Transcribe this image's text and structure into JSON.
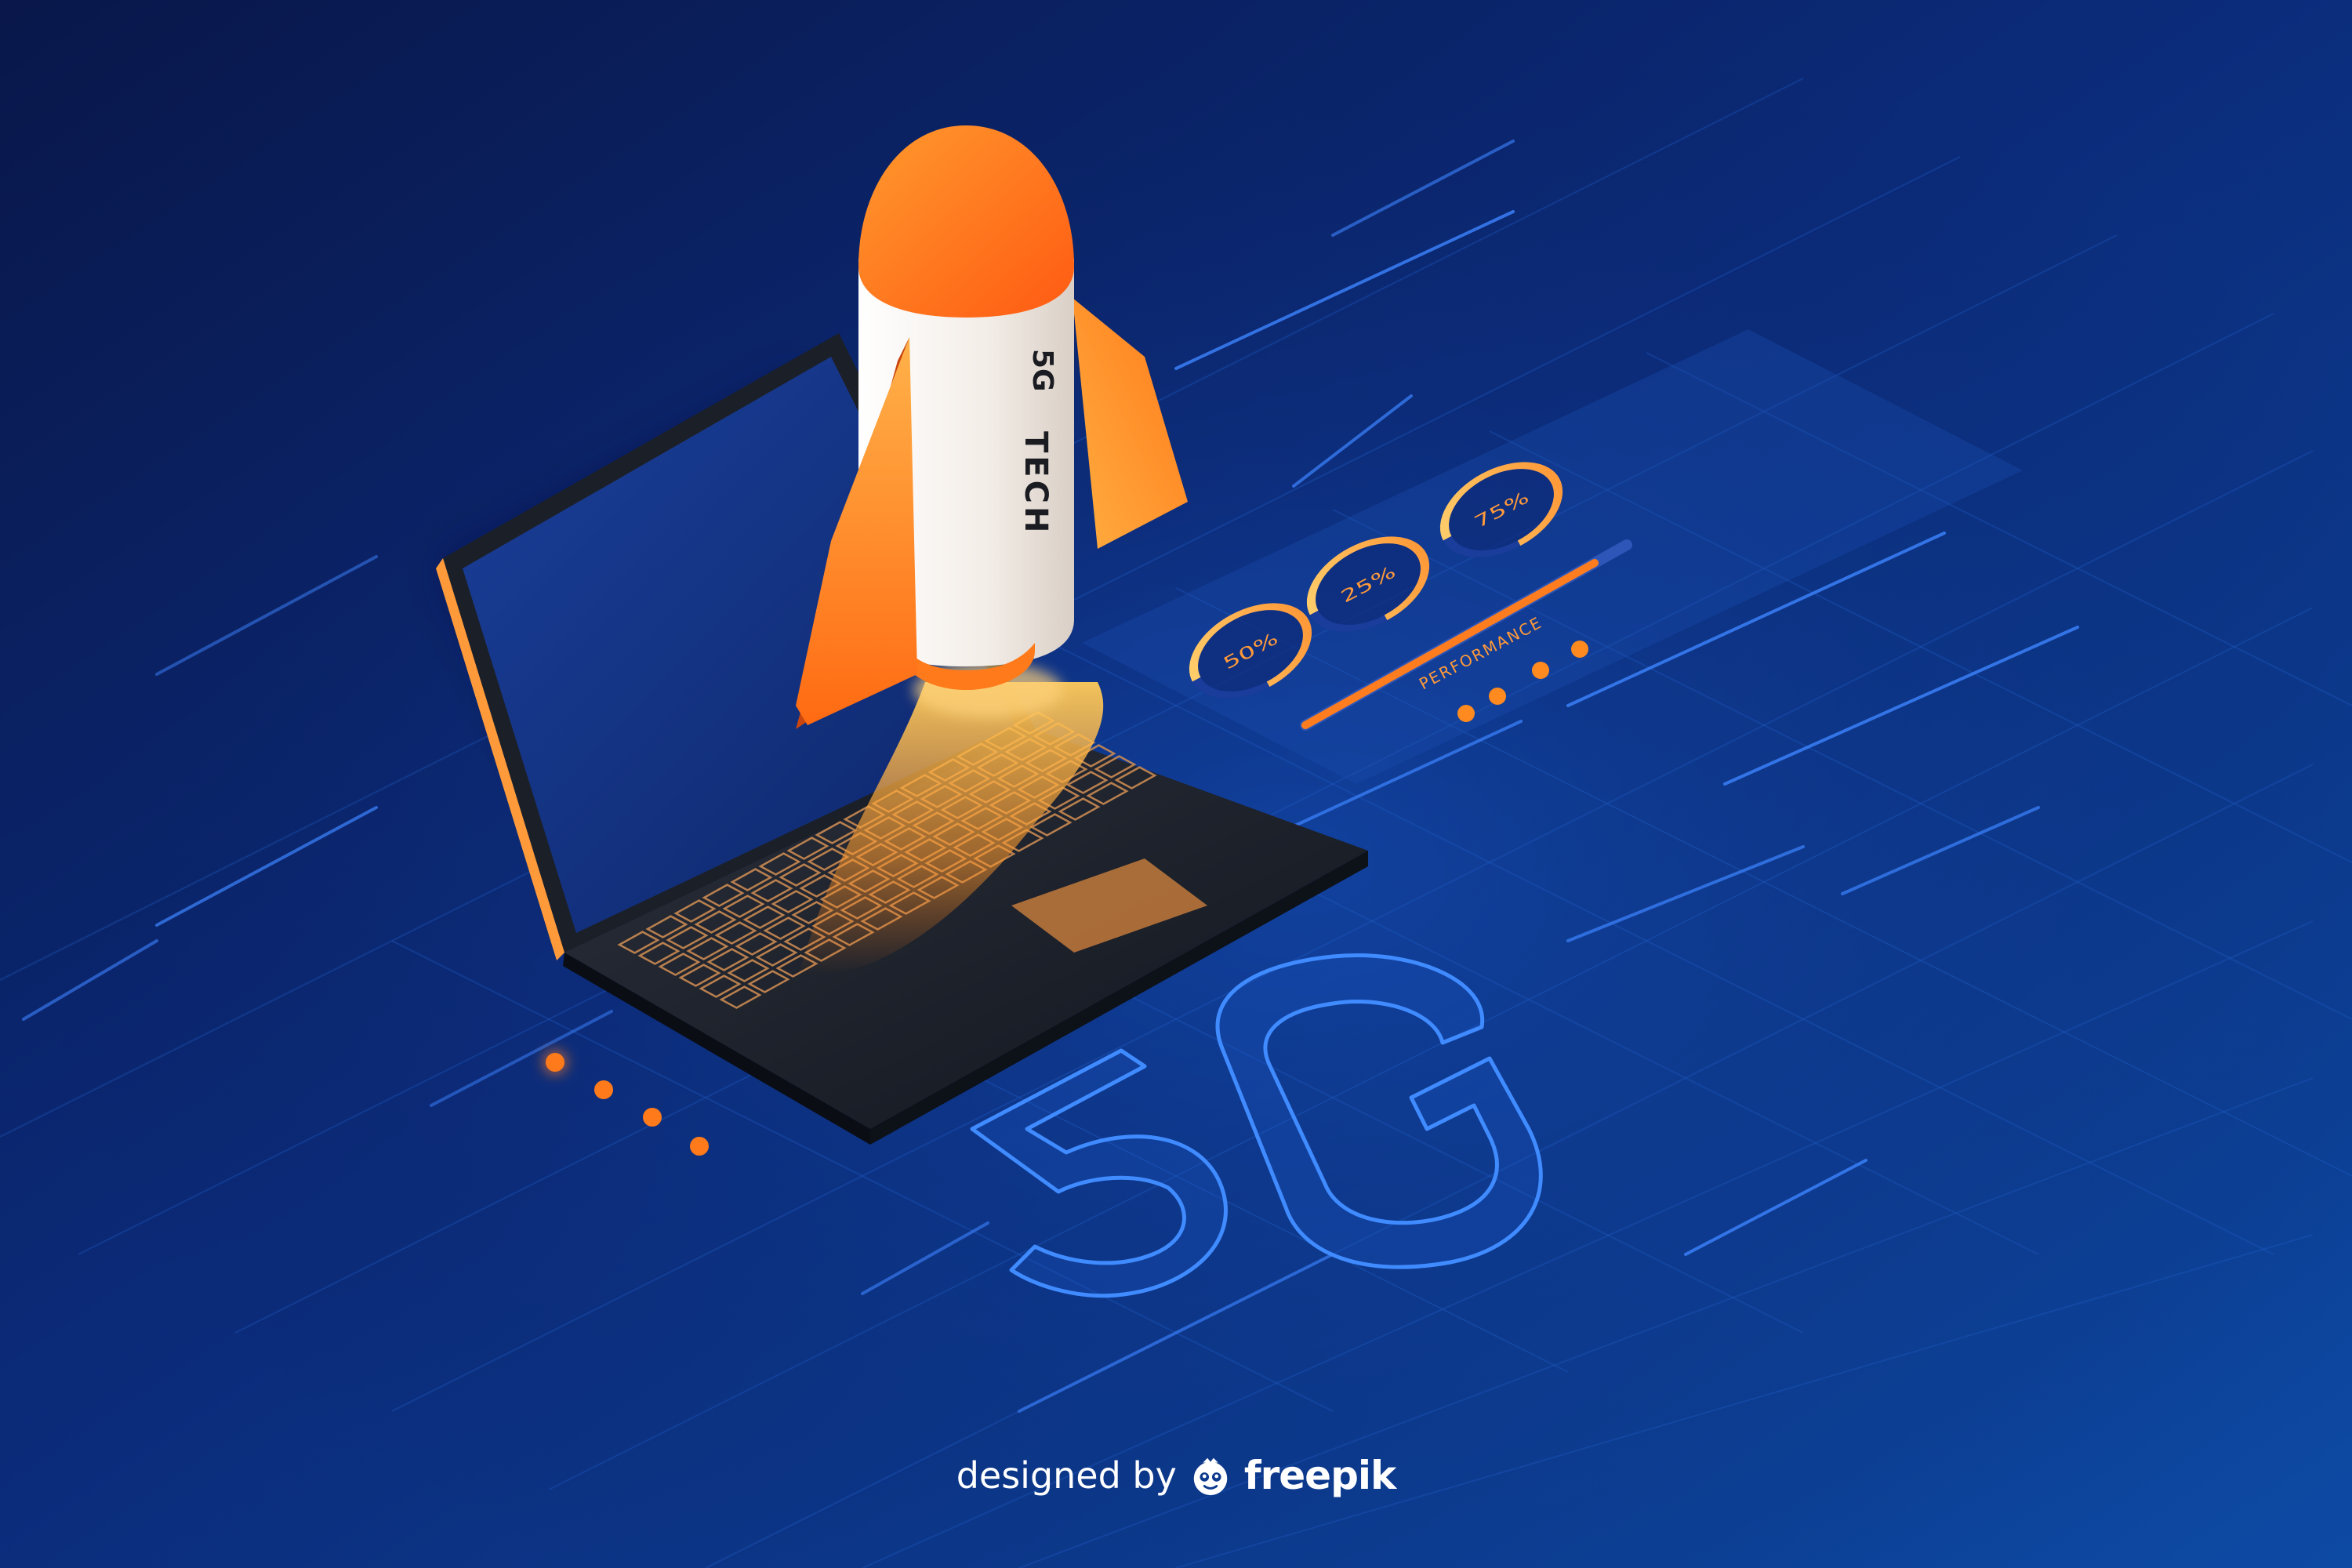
{
  "rocket": {
    "label_line1": "5G",
    "label_line2": "TECH"
  },
  "dashboard": {
    "gauges": [
      {
        "label": "50%",
        "value": 0.5
      },
      {
        "label": "25%",
        "value": 0.25
      },
      {
        "label": "75%",
        "value": 0.75
      }
    ],
    "performance_label": "PERFORMANCE",
    "performance_value": 0.9
  },
  "floor_text": "5G",
  "credit": {
    "prefix": "designed by",
    "brand": "freepik"
  },
  "colors": {
    "background_dark": "#0b1d5a",
    "background_light": "#0e4aa0",
    "accent_orange": "#ff8a1f",
    "rocket_orange": "#ff6a1a",
    "grid_blue": "#1f5cc4"
  },
  "icons": {
    "credit_logo": "freepik-logo-icon"
  }
}
